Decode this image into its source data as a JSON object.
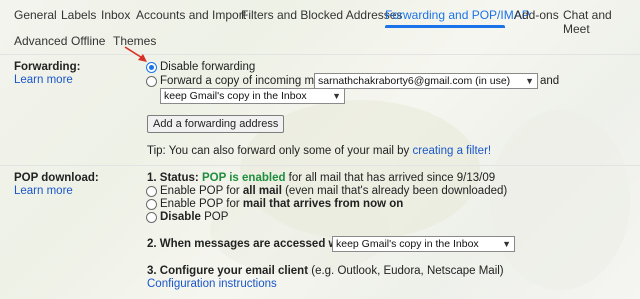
{
  "tabs": {
    "general": "General",
    "labels": "Labels",
    "inbox": "Inbox",
    "accounts": "Accounts and Import",
    "filters": "Filters and Blocked Addresses",
    "forwarding": "Forwarding and POP/IMAP",
    "addons": "Add-ons",
    "chat": "Chat and Meet",
    "advanced": "Advanced",
    "offline": "Offline",
    "themes": "Themes"
  },
  "forwarding": {
    "label": "Forwarding:",
    "learn_more": "Learn more",
    "disable_label": "Disable forwarding",
    "forward_label": "Forward a copy of incoming mail to",
    "email_value": "sarnathchakraborty6@gmail.com (in use)",
    "and_text": "and",
    "keep_value": "keep Gmail's copy in the Inbox",
    "add_button": "Add a forwarding address",
    "tip_prefix": "Tip: You can also forward only some of your mail by ",
    "tip_link": "creating a filter!"
  },
  "pop": {
    "label": "POP download:",
    "learn_more": "Learn more",
    "status_prefix": "1. Status: ",
    "status_enabled": "POP is enabled",
    "status_suffix": " for all mail that has arrived since 9/13/09",
    "opt1_a": "Enable POP for ",
    "opt1_b": "all mail",
    "opt1_c": " (even mail that's already been downloaded)",
    "opt2_a": "Enable POP for ",
    "opt2_b": "mail that arrives from now on",
    "opt3_a": "Disable",
    "opt3_b": " POP",
    "access_label": "2. When messages are accessed with POP",
    "access_value": "keep Gmail's copy in the Inbox",
    "configure_label": "3. Configure your email client",
    "configure_suffix": " (e.g. Outlook, Eudora, Netscape Mail)",
    "config_link": "Configuration instructions"
  },
  "colors": {
    "accent": "#1a73e8",
    "link": "#1a56c9",
    "enabled": "#1e8e3e",
    "arrow": "#d93025"
  }
}
